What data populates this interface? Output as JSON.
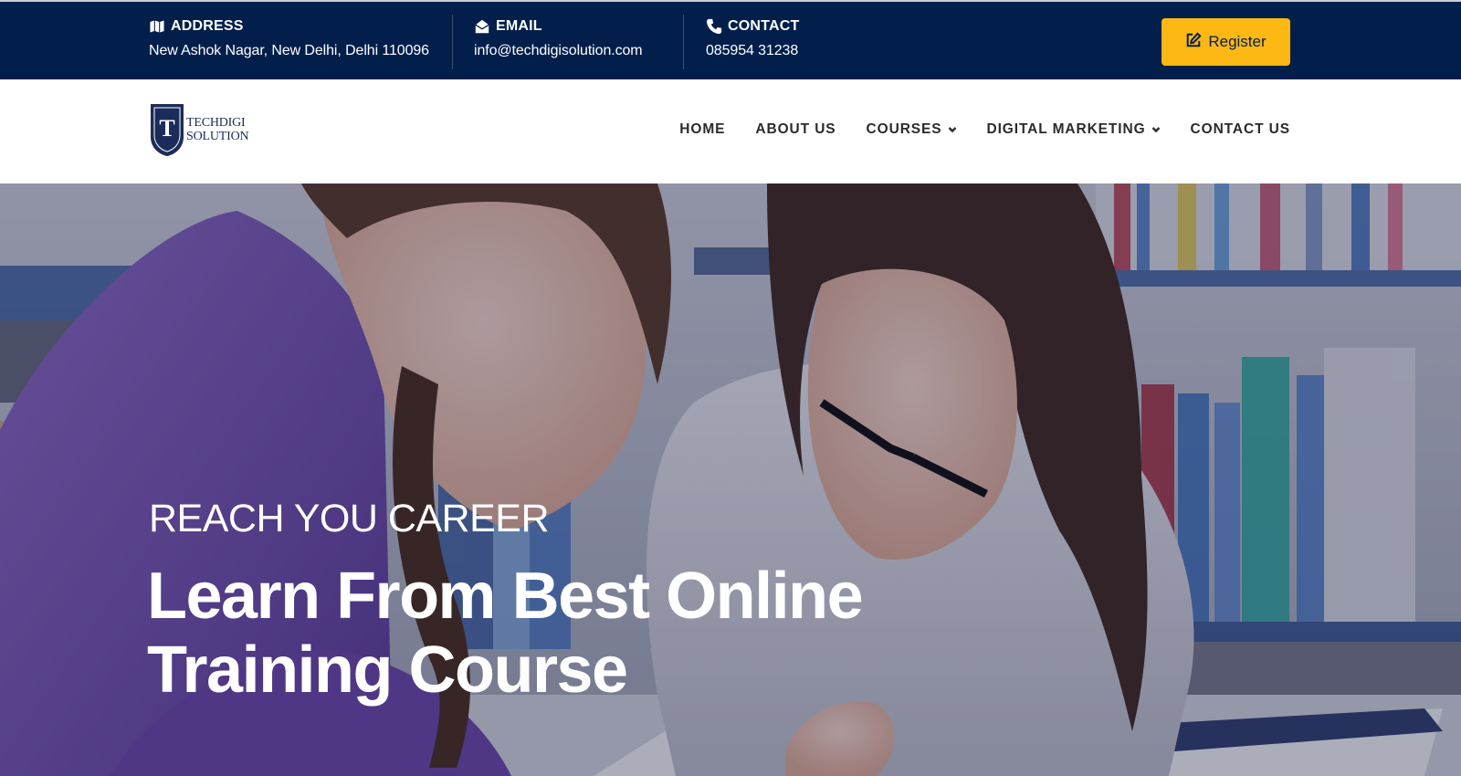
{
  "topbar": {
    "address": {
      "icon": "map-icon",
      "label": "ADDRESS",
      "value": "New Ashok Nagar, New Delhi, Delhi 110096"
    },
    "email": {
      "icon": "envelope-icon",
      "label": "EMAIL",
      "value": "info@techdigisolution.com"
    },
    "contact": {
      "icon": "phone-icon",
      "label": "CONTACT",
      "value": "085954 31238"
    },
    "register": {
      "icon": "edit-icon",
      "label": "Register"
    }
  },
  "brand": {
    "name_line1": "TECHDIGI",
    "name_line2": "SOLUTION",
    "mark": "T"
  },
  "nav": {
    "items": [
      {
        "label": "HOME",
        "dropdown": false
      },
      {
        "label": "ABOUT US",
        "dropdown": false
      },
      {
        "label": "COURSES",
        "dropdown": true
      },
      {
        "label": "DIGITAL MARKETING",
        "dropdown": true
      },
      {
        "label": "CONTACT US",
        "dropdown": false
      }
    ]
  },
  "hero": {
    "subtitle": "REACH YOU CAREER",
    "title_line1": "Learn From Best Online",
    "title_line2": "Training Course"
  },
  "colors": {
    "navy": "#021f4b",
    "accent": "#fdb813",
    "white": "#ffffff"
  }
}
